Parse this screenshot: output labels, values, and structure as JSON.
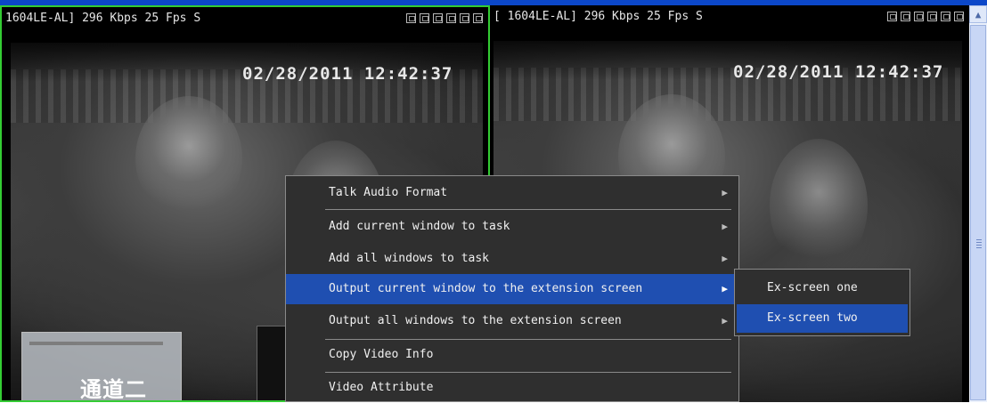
{
  "left_pane": {
    "title": "1604LE-AL] 296 Kbps 25 Fps S",
    "timestamp": "02/28/2011 12:42:37",
    "channel_label": "通道二"
  },
  "right_pane": {
    "title": "[ 1604LE-AL] 296 Kbps 25 Fps S",
    "timestamp": "02/28/2011 12:42:37"
  },
  "menu": {
    "items": [
      {
        "label": "Talk Audio Format",
        "submenu": true
      },
      {
        "label": "Add current window to task",
        "submenu": true
      },
      {
        "label": "Add all windows to task",
        "submenu": true
      },
      {
        "label": "Output current window to the extension screen",
        "submenu": true
      },
      {
        "label": "Output all windows to the extension screen",
        "submenu": true
      },
      {
        "label": "Copy Video Info",
        "submenu": false
      },
      {
        "label": "Video Attribute",
        "submenu": false
      }
    ]
  },
  "submenu": {
    "items": [
      {
        "label": "Ex-screen one"
      },
      {
        "label": "Ex-screen two"
      }
    ]
  },
  "icons": {
    "submenu_arrow": "▶",
    "scroll_up": "▲"
  },
  "colors": {
    "highlight": "#1f4fb1",
    "active_border": "#33cc33",
    "menu_bg": "#2f2f2f"
  }
}
